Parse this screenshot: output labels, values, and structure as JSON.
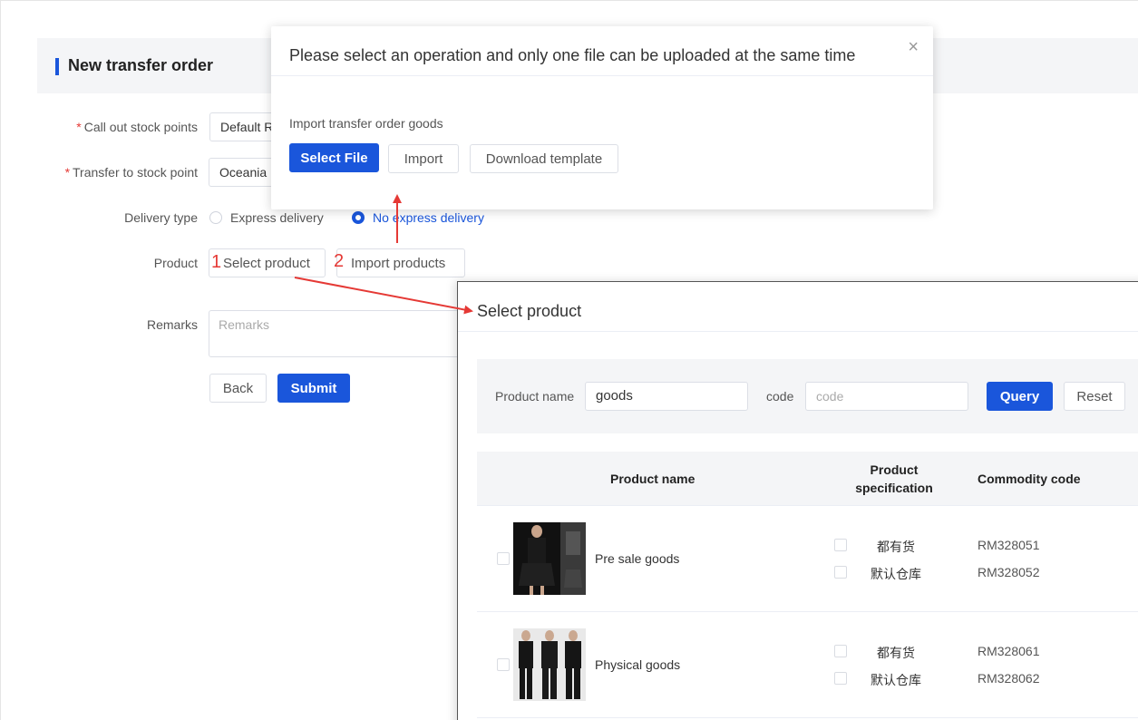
{
  "header": {
    "title": "New transfer order"
  },
  "form": {
    "call_out": {
      "label": "Call out stock points",
      "value": "Default R"
    },
    "transfer_to": {
      "label": "Transfer to stock point",
      "value": "Oceania"
    },
    "delivery": {
      "label": "Delivery type",
      "option_express": "Express delivery",
      "option_no_express": "No express delivery",
      "selected": "No express delivery"
    },
    "product": {
      "label": "Product",
      "select_button": "Select product",
      "import_button": "Import products",
      "step1": "1",
      "step2": "2"
    },
    "remarks": {
      "label": "Remarks",
      "placeholder": "Remarks"
    },
    "back_button": "Back",
    "submit_button": "Submit"
  },
  "upload_dialog": {
    "title": "Please select an operation and only one file can be uploaded at the same time",
    "close": "×",
    "section_label": "Import transfer order goods",
    "select_file_button": "Select File",
    "import_button": "Import",
    "download_button": "Download template"
  },
  "product_panel": {
    "title": "Select product",
    "search": {
      "name_label": "Product name",
      "name_value": "goods",
      "code_label": "code",
      "code_placeholder": "code",
      "query_button": "Query",
      "reset_button": "Reset"
    },
    "columns": {
      "name": "Product name",
      "spec_line1": "Product",
      "spec_line2": "specification",
      "code": "Commodity code"
    },
    "rows": [
      {
        "name": "Pre sale goods",
        "specs": [
          {
            "spec": "都有货",
            "code": "RM328051"
          },
          {
            "spec": "默认仓库",
            "code": "RM328052"
          }
        ]
      },
      {
        "name": "Physical goods",
        "specs": [
          {
            "spec": "都有货",
            "code": "RM328061"
          },
          {
            "spec": "默认仓库",
            "code": "RM328062"
          }
        ]
      }
    ]
  },
  "colors": {
    "accent": "#1a56db",
    "annotation_red": "#e53935",
    "header_bg": "#f4f5f7"
  }
}
